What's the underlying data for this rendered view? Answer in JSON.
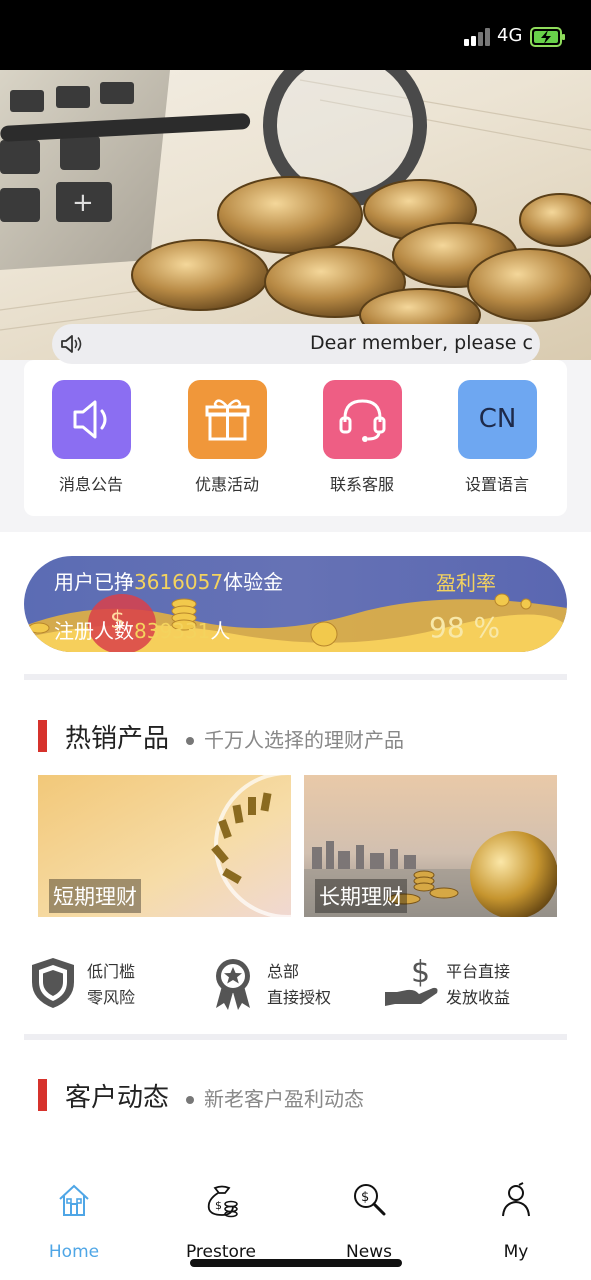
{
  "status_bar": {
    "network": "4G"
  },
  "notice": {
    "text": "Dear member, please c"
  },
  "quick_menu": [
    {
      "label": "消息公告",
      "icon": "speaker-icon",
      "color": "#8b6ef2"
    },
    {
      "label": "优惠活动",
      "icon": "gift-icon",
      "color": "#f0973a"
    },
    {
      "label": "联系客服",
      "icon": "headset-icon",
      "color": "#ee5e84"
    },
    {
      "label": "设置语言",
      "icon": "language-icon",
      "color": "#6ea7f1",
      "icon_text": "CN"
    }
  ],
  "profit_banner": {
    "earned_prefix": "用户已挣",
    "earned_amount": "3616057",
    "earned_suffix": "体验金",
    "registered_prefix": "注册人数",
    "registered_count": "839331",
    "registered_suffix": "人",
    "rate_label": "盈利率",
    "rate_value": "98 %"
  },
  "hot_products": {
    "title": "热销产品",
    "subtitle": "千万人选择的理财产品",
    "items": [
      {
        "label": "短期理财"
      },
      {
        "label": "长期理财"
      }
    ]
  },
  "features": [
    {
      "line1": "低门槛",
      "line2": "零风险",
      "icon": "shield-icon"
    },
    {
      "line1": "总部",
      "line2": "直接授权",
      "icon": "award-badge-icon"
    },
    {
      "line1": "平台直接",
      "line2": "发放收益",
      "icon": "hand-dollar-icon"
    }
  ],
  "customer_updates": {
    "title": "客户动态",
    "subtitle": "新老客户盈利动态"
  },
  "tab_bar": {
    "tabs": [
      {
        "label": "Home",
        "icon": "home-icon",
        "active": true
      },
      {
        "label": "Prestore",
        "icon": "money-bag-icon"
      },
      {
        "label": "News",
        "icon": "search-dollar-icon"
      },
      {
        "label": "My",
        "icon": "user-icon"
      }
    ],
    "active_color": "#4fa6e6"
  }
}
